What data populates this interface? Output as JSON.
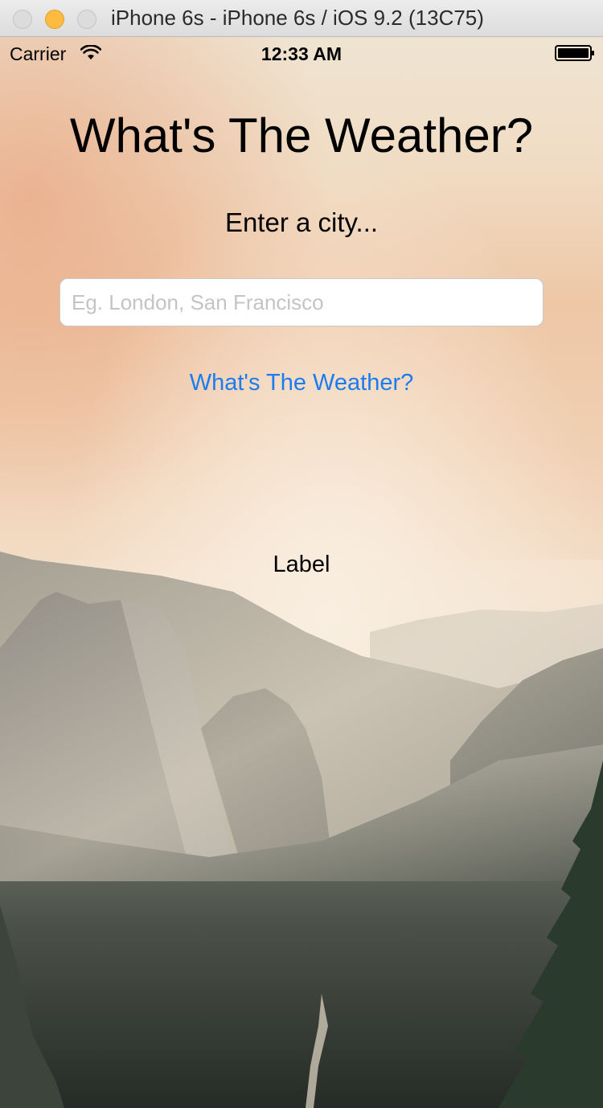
{
  "window": {
    "title": "iPhone 6s - iPhone 6s / iOS 9.2 (13C75)"
  },
  "status_bar": {
    "carrier": "Carrier",
    "time": "12:33 AM",
    "icons": [
      "wifi-icon",
      "battery-icon"
    ]
  },
  "app": {
    "title": "What's The Weather?",
    "prompt": "Enter a city...",
    "city_input": {
      "value": "",
      "placeholder": "Eg. London, San Francisco"
    },
    "button_label": "What's The Weather?",
    "result_label": "Label"
  },
  "colors": {
    "tint": "#1a7cf0",
    "title_bar": "#e2e2e2",
    "minimize_button": "#fdbc40"
  }
}
